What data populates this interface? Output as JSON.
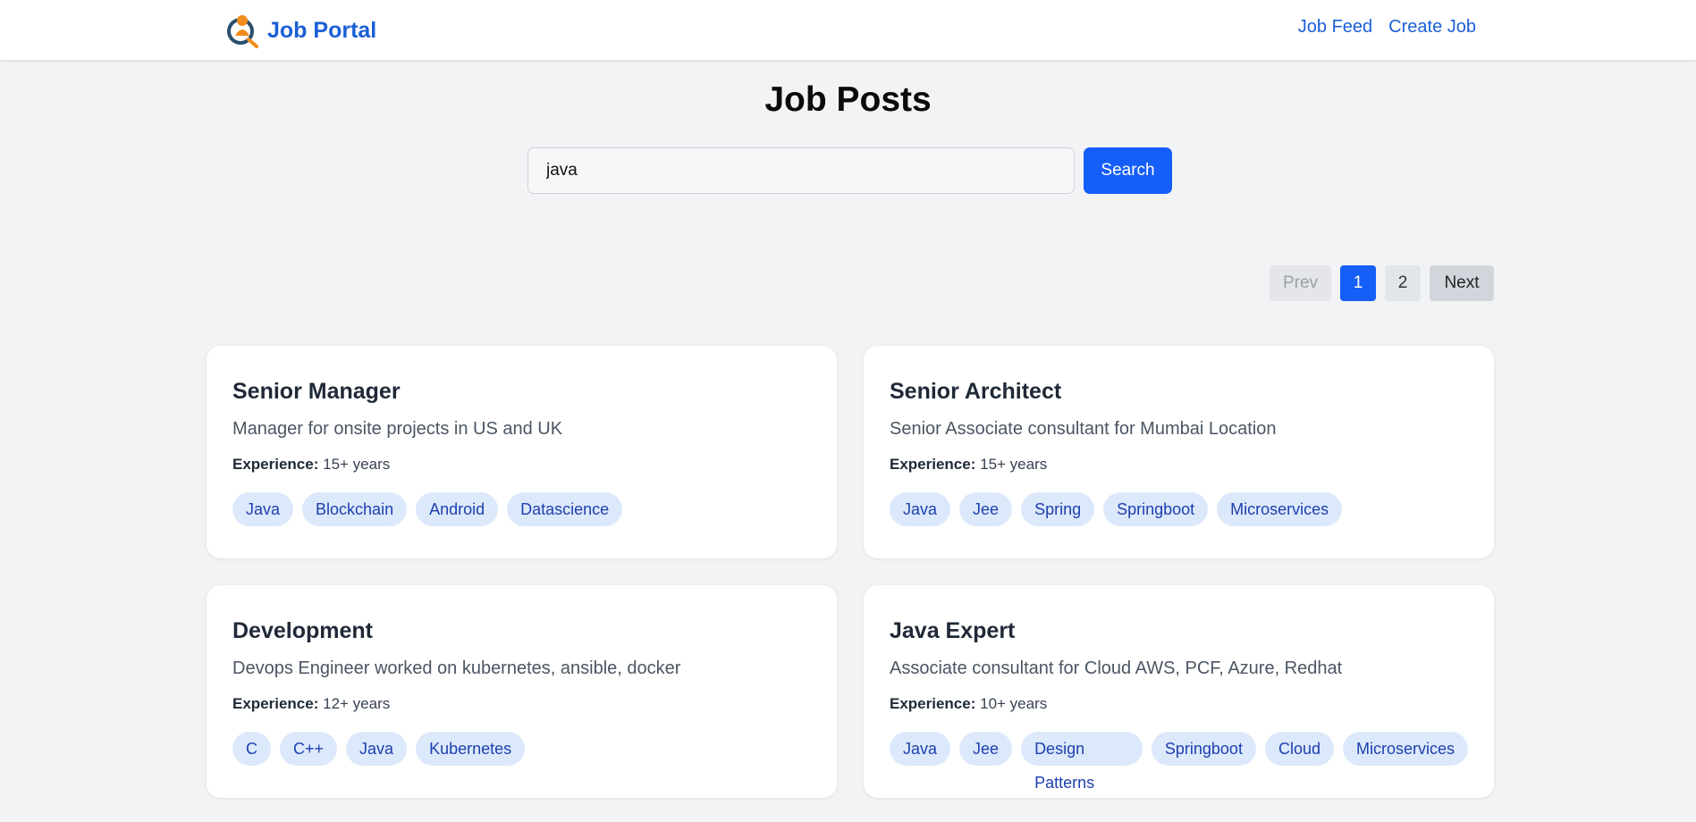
{
  "nav": {
    "brand": "Job Portal",
    "links": [
      "Job Feed",
      "Create Job"
    ]
  },
  "page": {
    "title": "Job Posts"
  },
  "search": {
    "value": "java",
    "button_label": "Search"
  },
  "pagination": {
    "prev_label": "Prev",
    "pages": [
      "1",
      "2"
    ],
    "active_page": "1",
    "next_label": "Next"
  },
  "colors": {
    "accent": "#155ef7",
    "brand": "#1b5fd6",
    "tag_bg": "#dce9fb",
    "tag_text": "#1e40af",
    "background": "#f2f3f5"
  },
  "experience_label": "Experience:",
  "jobs": [
    {
      "title": "Senior Manager",
      "description": "Manager for onsite projects in US and UK",
      "experience": "15+ years",
      "tags": [
        "Java",
        "Blockchain",
        "Android",
        "Datascience"
      ]
    },
    {
      "title": "Senior Architect",
      "description": "Senior Associate consultant for Mumbai Location",
      "experience": "15+ years",
      "tags": [
        "Java",
        "Jee",
        "Spring",
        "Springboot",
        "Microservices"
      ]
    },
    {
      "title": "Development",
      "description": "Devops Engineer worked on kubernetes, ansible, docker",
      "experience": "12+ years",
      "tags": [
        "C",
        "C++",
        "Java",
        "Kubernetes"
      ]
    },
    {
      "title": "Java Expert",
      "description": "Associate consultant for Cloud AWS, PCF, Azure, Redhat",
      "experience": "10+ years",
      "tags": [
        "Java",
        "Jee",
        "Design Patterns",
        "Springboot",
        "Cloud",
        "Microservices"
      ]
    }
  ]
}
